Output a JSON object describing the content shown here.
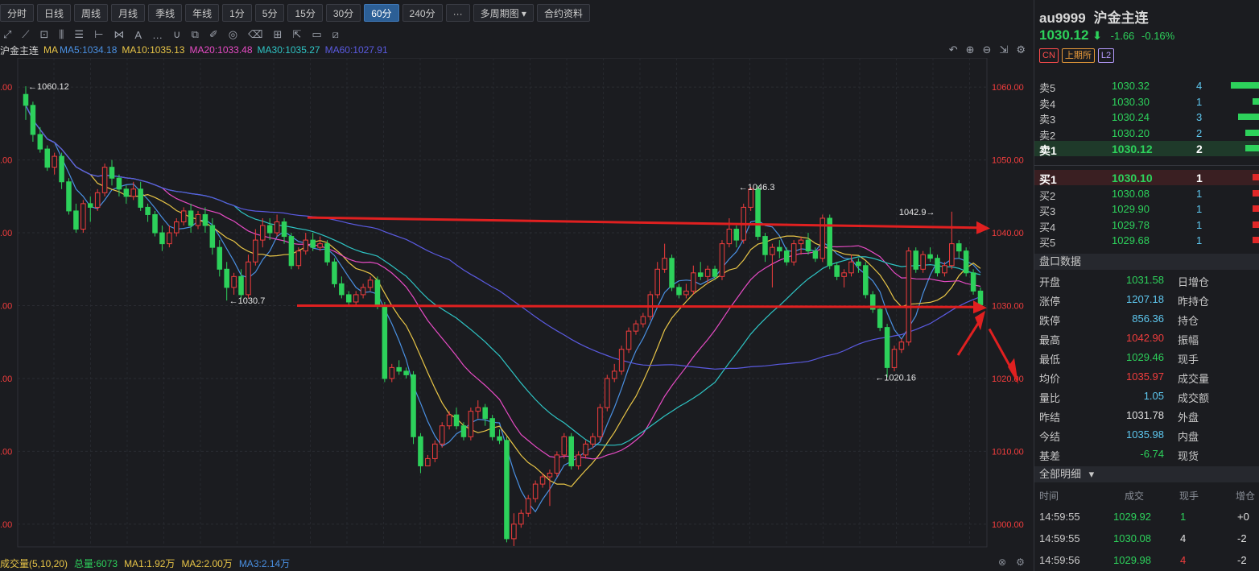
{
  "toolbar": {
    "periods": [
      "分时",
      "日线",
      "周线",
      "月线",
      "季线",
      "年线",
      "1分",
      "5分",
      "15分",
      "30分",
      "60分",
      "240分",
      "···",
      "多周期图",
      "合约资料"
    ],
    "active_period": "60分"
  },
  "ma_bar": {
    "symbol": "沪金主连",
    "label": "MA",
    "ma5": "MA5:1034.18",
    "ma10": "MA10:1035.13",
    "ma20": "MA20:1033.48",
    "ma30": "MA30:1035.27",
    "ma60": "MA60:1027.91"
  },
  "vol_bar": {
    "label": "成交量(5,10,20)",
    "total": "总量:6073",
    "ma1": "MA1:1.92万",
    "ma2": "MA2:2.00万",
    "ma3": "MA3:2.14万"
  },
  "colors": {
    "up": "#f23d3d",
    "down": "#2dd15b",
    "ma5": "#4a90e2",
    "ma10": "#e8c547",
    "ma20": "#e64bc4",
    "ma30": "#2ec4c4",
    "ma60": "#5a5ae0"
  },
  "chart_data": {
    "type": "candlestick",
    "ylim": [
      996,
      1064
    ],
    "yticks": [
      "1060.00",
      "1050.00",
      "1040.00",
      "1030.00",
      "1020.00",
      "1010.00",
      "1000.00"
    ],
    "left_ticks": [
      ".00",
      ".00",
      ".00",
      ".00",
      ".00",
      ".00",
      ".00"
    ],
    "annotations": [
      "←1060.12",
      "←1030.7",
      "←1046.3",
      "1042.9→",
      "←1020.16"
    ],
    "candles": [
      [
        1059,
        1057.5,
        1060.12,
        1055.5
      ],
      [
        1057.5,
        1053.5,
        1058,
        1052.5
      ],
      [
        1053.5,
        1051.5,
        1054.5,
        1051
      ],
      [
        1051.5,
        1049,
        1052,
        1048.5
      ],
      [
        1049,
        1050.5,
        1051,
        1048
      ],
      [
        1050.5,
        1047,
        1051,
        1046
      ],
      [
        1047,
        1043,
        1047.5,
        1042.5
      ],
      [
        1043,
        1040.5,
        1044,
        1040
      ],
      [
        1040.5,
        1044,
        1044.5,
        1040
      ],
      [
        1044,
        1043.5,
        1045,
        1041.5
      ],
      [
        1043.5,
        1045.5,
        1046,
        1043
      ],
      [
        1045.5,
        1049,
        1049.5,
        1045
      ],
      [
        1049,
        1047.5,
        1050,
        1046.5
      ],
      [
        1047.5,
        1046,
        1048,
        1045
      ],
      [
        1046,
        1045,
        1046.5,
        1044
      ],
      [
        1045,
        1046,
        1047,
        1044.5
      ],
      [
        1046,
        1043.5,
        1047,
        1043
      ],
      [
        1043.5,
        1042.5,
        1044,
        1041.5
      ],
      [
        1042.5,
        1040,
        1043,
        1039.5
      ],
      [
        1040,
        1038.5,
        1041,
        1037.5
      ],
      [
        1038.5,
        1040,
        1041,
        1038
      ],
      [
        1040,
        1041.5,
        1042,
        1039.5
      ],
      [
        1041.5,
        1043,
        1043.5,
        1041
      ],
      [
        1043,
        1041,
        1044,
        1040
      ],
      [
        1041,
        1042.5,
        1043,
        1040.5
      ],
      [
        1042.5,
        1041,
        1043.5,
        1040
      ],
      [
        1041,
        1038,
        1042,
        1037
      ],
      [
        1038,
        1035,
        1039,
        1034
      ],
      [
        1035,
        1032.5,
        1036,
        1030.7
      ],
      [
        1032.5,
        1034,
        1034.5,
        1031.5
      ],
      [
        1034,
        1031.5,
        1035,
        1031
      ],
      [
        1031.5,
        1036,
        1037,
        1031
      ],
      [
        1036,
        1039,
        1040.5,
        1035.5
      ],
      [
        1039,
        1041,
        1042,
        1038
      ],
      [
        1041,
        1040,
        1042,
        1039
      ],
      [
        1040,
        1041.5,
        1042.5,
        1039.5
      ],
      [
        1041.5,
        1039.5,
        1042,
        1038.5
      ],
      [
        1039.5,
        1035.5,
        1040,
        1035
      ],
      [
        1035.5,
        1037.5,
        1038,
        1035
      ],
      [
        1037.5,
        1039,
        1040,
        1037
      ],
      [
        1039,
        1038,
        1040,
        1037.5
      ],
      [
        1038,
        1038.5,
        1039.5,
        1037.5
      ],
      [
        1038.5,
        1036,
        1039,
        1035.5
      ],
      [
        1036,
        1033,
        1036.5,
        1032.5
      ],
      [
        1033,
        1031.5,
        1034,
        1031
      ],
      [
        1031.5,
        1030.5,
        1032,
        1030
      ],
      [
        1030.5,
        1031.5,
        1032,
        1030
      ],
      [
        1031.5,
        1032.5,
        1033,
        1031
      ],
      [
        1032.5,
        1033.5,
        1034,
        1032
      ],
      [
        1033.5,
        1030,
        1034,
        1029.5
      ],
      [
        1030,
        1020,
        1030.5,
        1019.5
      ],
      [
        1020,
        1021.5,
        1022,
        1019.5
      ],
      [
        1021.5,
        1021,
        1022.5,
        1020.5
      ],
      [
        1021,
        1020.5,
        1021.5,
        1020
      ],
      [
        1020.5,
        1012,
        1021,
        1011
      ],
      [
        1012,
        1008,
        1012.5,
        1007
      ],
      [
        1008,
        1009,
        1009.5,
        1008
      ],
      [
        1009,
        1011,
        1011.5,
        1008.5
      ],
      [
        1011,
        1013.5,
        1014,
        1010.5
      ],
      [
        1013.5,
        1015,
        1015.5,
        1013
      ],
      [
        1015,
        1013.5,
        1016,
        1013
      ],
      [
        1013.5,
        1012,
        1014,
        1011.5
      ],
      [
        1012,
        1015.5,
        1016,
        1011.5
      ],
      [
        1015.5,
        1016,
        1017,
        1014.5
      ],
      [
        1016,
        1014.5,
        1016.5,
        1013.5
      ],
      [
        1014.5,
        1012,
        1015,
        1011.5
      ],
      [
        1012,
        1011.5,
        1013,
        1011
      ],
      [
        1011.5,
        998,
        1012,
        997.5
      ],
      [
        998,
        1000,
        1001.5,
        997
      ],
      [
        1000,
        1001.5,
        1002,
        999.5
      ],
      [
        1001.5,
        1003.5,
        1004,
        1001
      ],
      [
        1003.5,
        1005.5,
        1006,
        1003
      ],
      [
        1005.5,
        1006.5,
        1007,
        1005
      ],
      [
        1006.5,
        1007,
        1007.5,
        1002.5
      ],
      [
        1007,
        1009.5,
        1010,
        1006.5
      ],
      [
        1009.5,
        1012,
        1012.5,
        1009
      ],
      [
        1012,
        1008,
        1012.5,
        1007.5
      ],
      [
        1008,
        1009.5,
        1010,
        1007.5
      ],
      [
        1009.5,
        1011,
        1011.5,
        1009
      ],
      [
        1011,
        1012,
        1012.5,
        1010.5
      ],
      [
        1012,
        1016,
        1016.5,
        1011.5
      ],
      [
        1016,
        1020,
        1020.5,
        1015.5
      ],
      [
        1020,
        1021,
        1022,
        1019.5
      ],
      [
        1021,
        1024,
        1024.5,
        1020.5
      ],
      [
        1024,
        1026.5,
        1027,
        1023.5
      ],
      [
        1026.5,
        1027.5,
        1028,
        1026
      ],
      [
        1027.5,
        1028.5,
        1029,
        1027
      ],
      [
        1028.5,
        1031.5,
        1032,
        1028
      ],
      [
        1031.5,
        1035,
        1036,
        1031
      ],
      [
        1035,
        1036.5,
        1038.5,
        1034.5
      ],
      [
        1036.5,
        1032.5,
        1037,
        1032
      ],
      [
        1032.5,
        1031.5,
        1033,
        1031
      ],
      [
        1031.5,
        1032,
        1033,
        1031
      ],
      [
        1032,
        1034.5,
        1035.5,
        1031.5
      ],
      [
        1034.5,
        1034,
        1036,
        1033.5
      ],
      [
        1034,
        1035,
        1035.5,
        1033
      ],
      [
        1035,
        1034,
        1035.5,
        1033.5
      ],
      [
        1034,
        1038.5,
        1039,
        1033.5
      ],
      [
        1038.5,
        1040.5,
        1042,
        1038
      ],
      [
        1040.5,
        1039,
        1041,
        1038
      ],
      [
        1039,
        1043.5,
        1044,
        1038.5
      ],
      [
        1043.5,
        1046,
        1046.3,
        1043
      ],
      [
        1046,
        1039.5,
        1046.5,
        1039
      ],
      [
        1039.5,
        1037,
        1040,
        1036
      ],
      [
        1037,
        1038,
        1038.5,
        1032.5
      ],
      [
        1038,
        1037.5,
        1039,
        1036.5
      ],
      [
        1037.5,
        1036,
        1038,
        1035.5
      ],
      [
        1036,
        1038.5,
        1039,
        1035.5
      ],
      [
        1038.5,
        1039,
        1039.5,
        1037
      ],
      [
        1039,
        1037.5,
        1040,
        1037
      ],
      [
        1037.5,
        1036.5,
        1038,
        1036
      ],
      [
        1036.5,
        1042,
        1042.5,
        1036
      ],
      [
        1042,
        1035.5,
        1042.5,
        1035
      ],
      [
        1035.5,
        1034,
        1036,
        1033.5
      ],
      [
        1034,
        1034.5,
        1035,
        1032.5
      ],
      [
        1034.5,
        1036,
        1037,
        1034
      ],
      [
        1036,
        1035.5,
        1036.5,
        1034.5
      ],
      [
        1035.5,
        1031.5,
        1036,
        1031
      ],
      [
        1031.5,
        1029.5,
        1032,
        1029
      ],
      [
        1029.5,
        1027,
        1030,
        1026.5
      ],
      [
        1027,
        1021.5,
        1027.5,
        1020.16
      ],
      [
        1021.5,
        1024,
        1024.5,
        1021
      ],
      [
        1024,
        1025,
        1025.5,
        1023.5
      ],
      [
        1025,
        1037.5,
        1038,
        1024.5
      ],
      [
        1037.5,
        1035,
        1038,
        1034.5
      ],
      [
        1035,
        1037,
        1037.5,
        1034.5
      ],
      [
        1037,
        1036.5,
        1038,
        1036
      ],
      [
        1036.5,
        1034.5,
        1037,
        1034
      ],
      [
        1034.5,
        1035.5,
        1036,
        1034
      ],
      [
        1035.5,
        1038.5,
        1042.9,
        1035
      ],
      [
        1038.5,
        1037.5,
        1039,
        1036.5
      ],
      [
        1037.5,
        1034.5,
        1038,
        1034
      ],
      [
        1034.5,
        1032,
        1035,
        1031.5
      ],
      [
        1032,
        1030.12,
        1032.5,
        1029.46
      ]
    ]
  },
  "panel": {
    "code": "au9999",
    "name": "沪金主连",
    "last_price": "1030.12",
    "arrow": "⬇",
    "change": "-1.66",
    "pct": "-0.16%",
    "tags": [
      "CN",
      "上期所",
      "L2"
    ],
    "asks": [
      {
        "label": "卖5",
        "price": "1030.32",
        "qty": "4",
        "bar": 36
      },
      {
        "label": "卖4",
        "price": "1030.30",
        "qty": "1",
        "bar": 9
      },
      {
        "label": "卖3",
        "price": "1030.24",
        "qty": "3",
        "bar": 27
      },
      {
        "label": "卖2",
        "price": "1030.20",
        "qty": "2",
        "bar": 18
      },
      {
        "label": "卖1",
        "price": "1030.12",
        "qty": "2",
        "bar": 18
      }
    ],
    "bids": [
      {
        "label": "买1",
        "price": "1030.10",
        "qty": "1",
        "bar": 9
      },
      {
        "label": "买2",
        "price": "1030.08",
        "qty": "1",
        "bar": 9
      },
      {
        "label": "买3",
        "price": "1029.90",
        "qty": "1",
        "bar": 9
      },
      {
        "label": "买4",
        "price": "1029.78",
        "qty": "1",
        "bar": 9
      },
      {
        "label": "买5",
        "price": "1029.68",
        "qty": "1",
        "bar": 9
      }
    ],
    "section_quote": "盘口数据",
    "stats": [
      {
        "label": "开盘",
        "value": "1031.58",
        "color": "#2dd15b",
        "label2": "日增仓"
      },
      {
        "label": "涨停",
        "value": "1207.18",
        "color": "#5ec8f0",
        "label2": "昨持仓"
      },
      {
        "label": "跌停",
        "value": "856.36",
        "color": "#5ec8f0",
        "label2": "持仓"
      },
      {
        "label": "最高",
        "value": "1042.90",
        "color": "#f23d3d",
        "label2": "振幅"
      },
      {
        "label": "最低",
        "value": "1029.46",
        "color": "#2dd15b",
        "label2": "现手"
      },
      {
        "label": "均价",
        "value": "1035.97",
        "color": "#f23d3d",
        "label2": "成交量"
      },
      {
        "label": "量比",
        "value": "1.05",
        "color": "#5ec8f0",
        "label2": "成交额"
      },
      {
        "label": "昨结",
        "value": "1031.78",
        "color": "#e0e0e0",
        "label2": "外盘"
      },
      {
        "label": "今结",
        "value": "1035.98",
        "color": "#5ec8f0",
        "label2": "内盘"
      },
      {
        "label": "基差",
        "value": "-6.74",
        "color": "#2dd15b",
        "label2": "现货"
      }
    ],
    "section_trades": "全部明细",
    "trade_headers": [
      "时间",
      "成交",
      "现手",
      "增仓"
    ],
    "trades": [
      {
        "time": "14:59:55",
        "price": "1029.92",
        "hand": "1",
        "inc": "+0",
        "hcolor": "#2dd15b"
      },
      {
        "time": "14:59:55",
        "price": "1030.08",
        "hand": "4",
        "inc": "-2",
        "hcolor": "#e0e0e0"
      },
      {
        "time": "14:59:56",
        "price": "1029.98",
        "hand": "4",
        "inc": "-2",
        "hcolor": "#f23d3d"
      }
    ]
  }
}
